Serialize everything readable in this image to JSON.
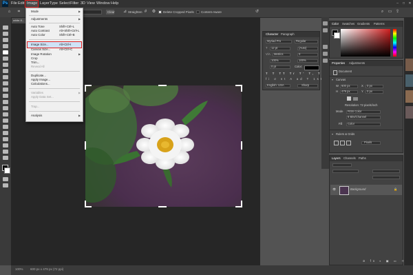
{
  "menubar": {
    "items": [
      "File",
      "Edit",
      "Image",
      "Layer",
      "Type",
      "Select",
      "Filter",
      "3D",
      "View",
      "Window",
      "Help"
    ],
    "active": "Image"
  },
  "options_bar": {
    "clear": "Clear",
    "straighten": "Straighten",
    "delete_cropped": "Delete Cropped Pixels",
    "content_aware": "Content-Aware"
  },
  "document_tab": "white-fl...",
  "image_menu": {
    "items": [
      {
        "label": "Mode",
        "shortcut": "",
        "submenu": true,
        "disabled": false
      },
      {
        "label": "Adjustments",
        "shortcut": "",
        "submenu": true,
        "disabled": false
      },
      {
        "label": "Auto Tone",
        "shortcut": "Shift+Ctrl+L",
        "submenu": false,
        "disabled": false
      },
      {
        "label": "Auto Contrast",
        "shortcut": "Alt+Shift+Ctrl+L",
        "submenu": false,
        "disabled": false
      },
      {
        "label": "Auto Color",
        "shortcut": "Shift+Ctrl+B",
        "submenu": false,
        "disabled": false
      },
      {
        "label": "Image Size...",
        "shortcut": "Alt+Ctrl+I",
        "submenu": false,
        "disabled": false,
        "highlighted": true
      },
      {
        "label": "Canvas Size...",
        "shortcut": "Alt+Ctrl+C",
        "submenu": false,
        "disabled": false
      },
      {
        "label": "Image Rotation",
        "shortcut": "",
        "submenu": true,
        "disabled": false
      },
      {
        "label": "Crop",
        "shortcut": "",
        "submenu": false,
        "disabled": false
      },
      {
        "label": "Trim...",
        "shortcut": "",
        "submenu": false,
        "disabled": false
      },
      {
        "label": "Reveal All",
        "shortcut": "",
        "submenu": false,
        "disabled": true
      },
      {
        "label": "Duplicate...",
        "shortcut": "",
        "submenu": false,
        "disabled": false
      },
      {
        "label": "Apply Image...",
        "shortcut": "",
        "submenu": false,
        "disabled": false
      },
      {
        "label": "Calculations...",
        "shortcut": "",
        "submenu": false,
        "disabled": false
      },
      {
        "label": "Variables",
        "shortcut": "",
        "submenu": true,
        "disabled": true
      },
      {
        "label": "Apply Data Set...",
        "shortcut": "",
        "submenu": false,
        "disabled": true
      },
      {
        "label": "Trap...",
        "shortcut": "",
        "submenu": false,
        "disabled": true
      },
      {
        "label": "Analysis",
        "shortcut": "",
        "submenu": true,
        "disabled": false
      }
    ]
  },
  "character_panel": {
    "tabs": [
      "Character",
      "Paragraph"
    ],
    "font": "Myriad Pro",
    "style": "Regular",
    "size": "12 pt",
    "leading": "(Auto)",
    "kerning": "Metrics",
    "tracking": "0",
    "scale_v": "100%",
    "scale_h": "100%",
    "baseline": "0 pt",
    "color_label": "Color:",
    "language": "English: USA",
    "aa": "Sharp"
  },
  "color_panel": {
    "tabs": [
      "Color",
      "Swatches",
      "Gradients",
      "Patterns"
    ],
    "swatch_color": "#d01f1f"
  },
  "properties_panel": {
    "tabs": [
      "Properties",
      "Adjustments"
    ],
    "document": "Document",
    "canvas_label": "Canvas",
    "w": "W",
    "h": "H",
    "w_val": "600 px",
    "h_val": "479 px",
    "x": "X",
    "y": "Y",
    "x_val": "0 px",
    "y_val": "0 px",
    "resolution": "Resolution: 72 pixels/inch",
    "mode_label": "Mode",
    "mode_val": "RGB Color",
    "depth_val": "8 Bits/Channel",
    "fill_label": "Fill",
    "fill_val": "Color",
    "rulers_label": "Rulers & Grids",
    "rulers_unit": "Pixels"
  },
  "layers_panel": {
    "tabs": [
      "Layers",
      "Channels",
      "Paths"
    ],
    "layer_name": "Background"
  },
  "statusbar": {
    "zoom": "100%",
    "info": "600 px x 479 px (72 ppi)"
  }
}
